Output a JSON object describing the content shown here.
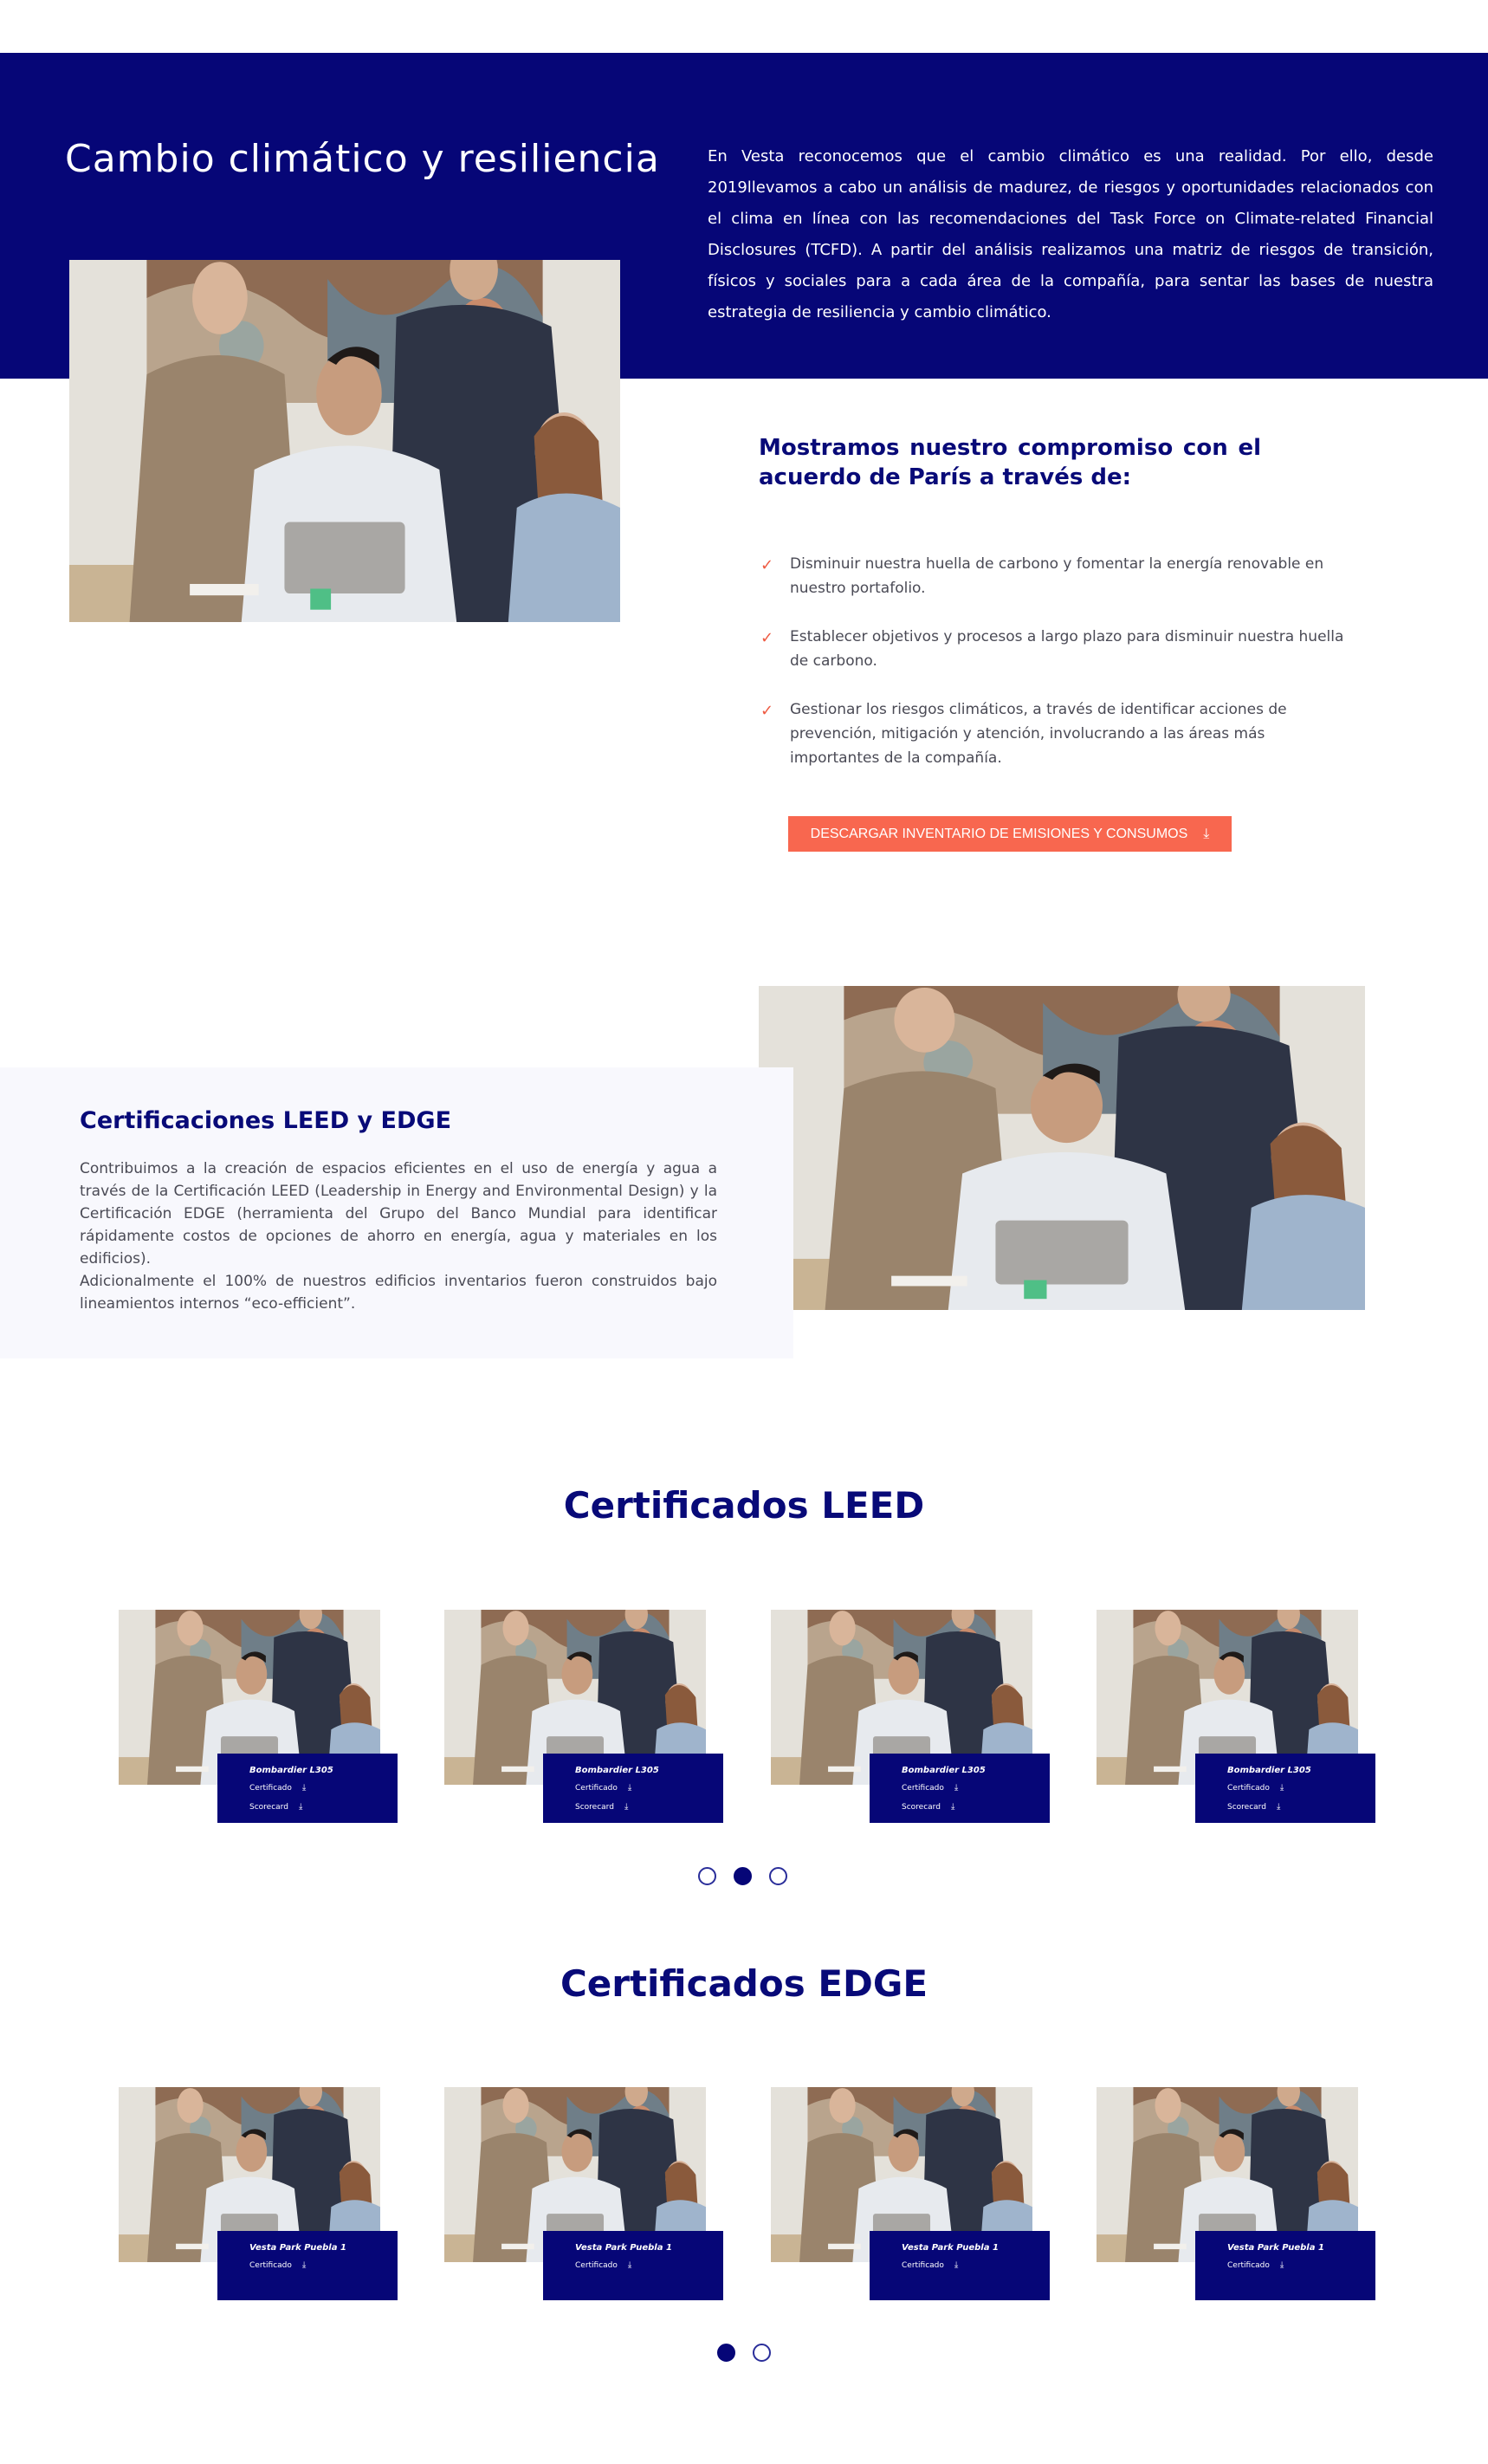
{
  "hero": {
    "title": "Cambio climático y resiliencia",
    "text": "En Vesta reconocemos que el cambio climático es una realidad. Por ello, desde 2019llevamos a cabo un análisis de madurez, de riesgos y oportunidades relacionados con el clima en línea con las recomendaciones del Task Force on Climate-related Financial Disclosures (TCFD). A partir del análisis realizamos una matriz de riesgos de transición, físicos y sociales para a cada área de la compañía, para sentar las bases de nuestra estrategia de resiliencia y cambio climático."
  },
  "commitment": {
    "heading_part1": "Mostramos nuestro ",
    "heading_bold1": "compromiso",
    "heading_part2": " con el ",
    "heading_bold2": "acuerdo de París",
    "heading_part3": " a través de:",
    "bullets": [
      "Disminuir nuestra huella de carbono y fomentar la energía renovable en nuestro portafolio.",
      "Establecer objetivos y procesos a largo plazo para disminuir nuestra huella de carbono.",
      "Gestionar los riesgos climáticos, a través de identificar acciones de prevención, mitigación y atención, involucrando a las áreas más importantes de la compañía."
    ],
    "check_icon": "✓",
    "cta_label": "DESCARGAR INVENTARIO DE EMISIONES Y CONSUMOS",
    "download_icon": "⤓"
  },
  "certifications": {
    "heading_part1": "Certificaciones ",
    "heading_bold": "LEED y EDGE",
    "paragraph1": "Contribuimos a la creación de espacios eficientes en el uso de energía y agua a través de la Certificación LEED (Leadership in Energy and Environmental Design) y la Certificación EDGE (herramienta del Grupo del Banco Mundial para identificar rápidamente costos de opciones de ahorro en energía, agua y materiales en los edificios).",
    "paragraph2": "Adicionalmente el 100% de nuestros edificios inventarios fueron construidos bajo lineamientos internos “eco-efficient”."
  },
  "leed": {
    "title_part1": "Certificados ",
    "title_bold": "LEED",
    "cards": [
      {
        "name": "Bombardier L305",
        "links": [
          "Certificado",
          "Scorecard"
        ]
      },
      {
        "name": "Bombardier L305",
        "links": [
          "Certificado",
          "Scorecard"
        ]
      },
      {
        "name": "Bombardier L305",
        "links": [
          "Certificado",
          "Scorecard"
        ]
      },
      {
        "name": "Bombardier L305",
        "links": [
          "Certificado",
          "Scorecard"
        ]
      }
    ],
    "dots": 3,
    "active_dot": 2
  },
  "edge": {
    "title_part1": "Certificados ",
    "title_bold": "EDGE",
    "cards": [
      {
        "name": "Vesta Park Puebla 1",
        "links": [
          "Certificado"
        ]
      },
      {
        "name": "Vesta Park Puebla 1",
        "links": [
          "Certificado"
        ]
      },
      {
        "name": "Vesta Park Puebla 1",
        "links": [
          "Certificado"
        ]
      },
      {
        "name": "Vesta Park Puebla 1",
        "links": [
          "Certificado"
        ]
      }
    ],
    "dots": 2,
    "active_dot": 1
  },
  "colors": {
    "navy": "#060677",
    "accent": "#f8674f",
    "light_panel": "#f8f8fd"
  }
}
